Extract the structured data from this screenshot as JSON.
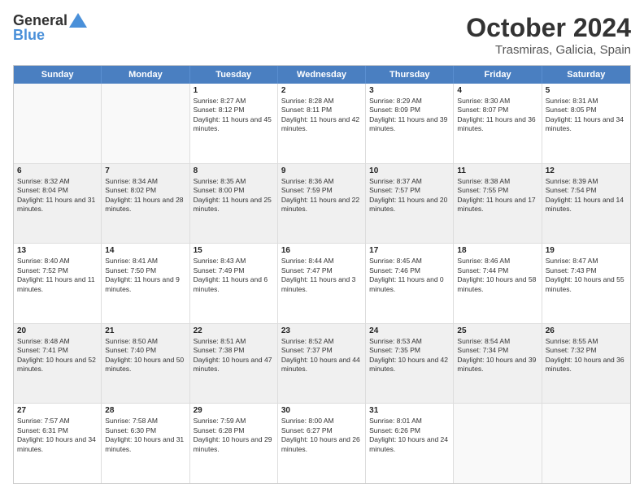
{
  "header": {
    "logo_general": "General",
    "logo_blue": "Blue",
    "title": "October 2024",
    "subtitle": "Trasmiras, Galicia, Spain"
  },
  "weekdays": [
    "Sunday",
    "Monday",
    "Tuesday",
    "Wednesday",
    "Thursday",
    "Friday",
    "Saturday"
  ],
  "rows": [
    [
      {
        "day": "",
        "text": ""
      },
      {
        "day": "",
        "text": ""
      },
      {
        "day": "1",
        "text": "Sunrise: 8:27 AM\nSunset: 8:12 PM\nDaylight: 11 hours and 45 minutes."
      },
      {
        "day": "2",
        "text": "Sunrise: 8:28 AM\nSunset: 8:11 PM\nDaylight: 11 hours and 42 minutes."
      },
      {
        "day": "3",
        "text": "Sunrise: 8:29 AM\nSunset: 8:09 PM\nDaylight: 11 hours and 39 minutes."
      },
      {
        "day": "4",
        "text": "Sunrise: 8:30 AM\nSunset: 8:07 PM\nDaylight: 11 hours and 36 minutes."
      },
      {
        "day": "5",
        "text": "Sunrise: 8:31 AM\nSunset: 8:05 PM\nDaylight: 11 hours and 34 minutes."
      }
    ],
    [
      {
        "day": "6",
        "text": "Sunrise: 8:32 AM\nSunset: 8:04 PM\nDaylight: 11 hours and 31 minutes."
      },
      {
        "day": "7",
        "text": "Sunrise: 8:34 AM\nSunset: 8:02 PM\nDaylight: 11 hours and 28 minutes."
      },
      {
        "day": "8",
        "text": "Sunrise: 8:35 AM\nSunset: 8:00 PM\nDaylight: 11 hours and 25 minutes."
      },
      {
        "day": "9",
        "text": "Sunrise: 8:36 AM\nSunset: 7:59 PM\nDaylight: 11 hours and 22 minutes."
      },
      {
        "day": "10",
        "text": "Sunrise: 8:37 AM\nSunset: 7:57 PM\nDaylight: 11 hours and 20 minutes."
      },
      {
        "day": "11",
        "text": "Sunrise: 8:38 AM\nSunset: 7:55 PM\nDaylight: 11 hours and 17 minutes."
      },
      {
        "day": "12",
        "text": "Sunrise: 8:39 AM\nSunset: 7:54 PM\nDaylight: 11 hours and 14 minutes."
      }
    ],
    [
      {
        "day": "13",
        "text": "Sunrise: 8:40 AM\nSunset: 7:52 PM\nDaylight: 11 hours and 11 minutes."
      },
      {
        "day": "14",
        "text": "Sunrise: 8:41 AM\nSunset: 7:50 PM\nDaylight: 11 hours and 9 minutes."
      },
      {
        "day": "15",
        "text": "Sunrise: 8:43 AM\nSunset: 7:49 PM\nDaylight: 11 hours and 6 minutes."
      },
      {
        "day": "16",
        "text": "Sunrise: 8:44 AM\nSunset: 7:47 PM\nDaylight: 11 hours and 3 minutes."
      },
      {
        "day": "17",
        "text": "Sunrise: 8:45 AM\nSunset: 7:46 PM\nDaylight: 11 hours and 0 minutes."
      },
      {
        "day": "18",
        "text": "Sunrise: 8:46 AM\nSunset: 7:44 PM\nDaylight: 10 hours and 58 minutes."
      },
      {
        "day": "19",
        "text": "Sunrise: 8:47 AM\nSunset: 7:43 PM\nDaylight: 10 hours and 55 minutes."
      }
    ],
    [
      {
        "day": "20",
        "text": "Sunrise: 8:48 AM\nSunset: 7:41 PM\nDaylight: 10 hours and 52 minutes."
      },
      {
        "day": "21",
        "text": "Sunrise: 8:50 AM\nSunset: 7:40 PM\nDaylight: 10 hours and 50 minutes."
      },
      {
        "day": "22",
        "text": "Sunrise: 8:51 AM\nSunset: 7:38 PM\nDaylight: 10 hours and 47 minutes."
      },
      {
        "day": "23",
        "text": "Sunrise: 8:52 AM\nSunset: 7:37 PM\nDaylight: 10 hours and 44 minutes."
      },
      {
        "day": "24",
        "text": "Sunrise: 8:53 AM\nSunset: 7:35 PM\nDaylight: 10 hours and 42 minutes."
      },
      {
        "day": "25",
        "text": "Sunrise: 8:54 AM\nSunset: 7:34 PM\nDaylight: 10 hours and 39 minutes."
      },
      {
        "day": "26",
        "text": "Sunrise: 8:55 AM\nSunset: 7:32 PM\nDaylight: 10 hours and 36 minutes."
      }
    ],
    [
      {
        "day": "27",
        "text": "Sunrise: 7:57 AM\nSunset: 6:31 PM\nDaylight: 10 hours and 34 minutes."
      },
      {
        "day": "28",
        "text": "Sunrise: 7:58 AM\nSunset: 6:30 PM\nDaylight: 10 hours and 31 minutes."
      },
      {
        "day": "29",
        "text": "Sunrise: 7:59 AM\nSunset: 6:28 PM\nDaylight: 10 hours and 29 minutes."
      },
      {
        "day": "30",
        "text": "Sunrise: 8:00 AM\nSunset: 6:27 PM\nDaylight: 10 hours and 26 minutes."
      },
      {
        "day": "31",
        "text": "Sunrise: 8:01 AM\nSunset: 6:26 PM\nDaylight: 10 hours and 24 minutes."
      },
      {
        "day": "",
        "text": ""
      },
      {
        "day": "",
        "text": ""
      }
    ]
  ]
}
